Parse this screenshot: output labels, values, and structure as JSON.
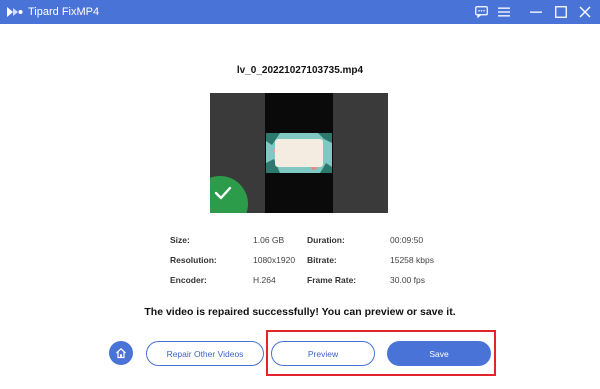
{
  "app": {
    "title": "Tipard FixMP4",
    "logo_icon": "play-arrows-icon",
    "accent_color": "#4a73d8"
  },
  "titlebar": {
    "icons": [
      "feedback-icon",
      "menu-icon",
      "minimize-icon",
      "maximize-icon",
      "close-icon"
    ]
  },
  "file": {
    "name": "lv_0_20221027103735.mp4",
    "status_icon": "check-icon",
    "status_color": "#2d9c4a"
  },
  "info": {
    "size_label": "Size:",
    "size_value": "1.06 GB",
    "duration_label": "Duration:",
    "duration_value": "00:09:50",
    "resolution_label": "Resolution:",
    "resolution_value": "1080x1920",
    "bitrate_label": "Bitrate:",
    "bitrate_value": "15258 kbps",
    "encoder_label": "Encoder:",
    "encoder_value": "H.264",
    "framerate_label": "Frame Rate:",
    "framerate_value": "30.00 fps"
  },
  "message": "The video is repaired successfully! You can preview or save it.",
  "actions": {
    "home_icon": "home-icon",
    "repair_other_label": "Repair Other Videos",
    "preview_label": "Preview",
    "save_label": "Save",
    "highlight_color": "#e0262a"
  }
}
